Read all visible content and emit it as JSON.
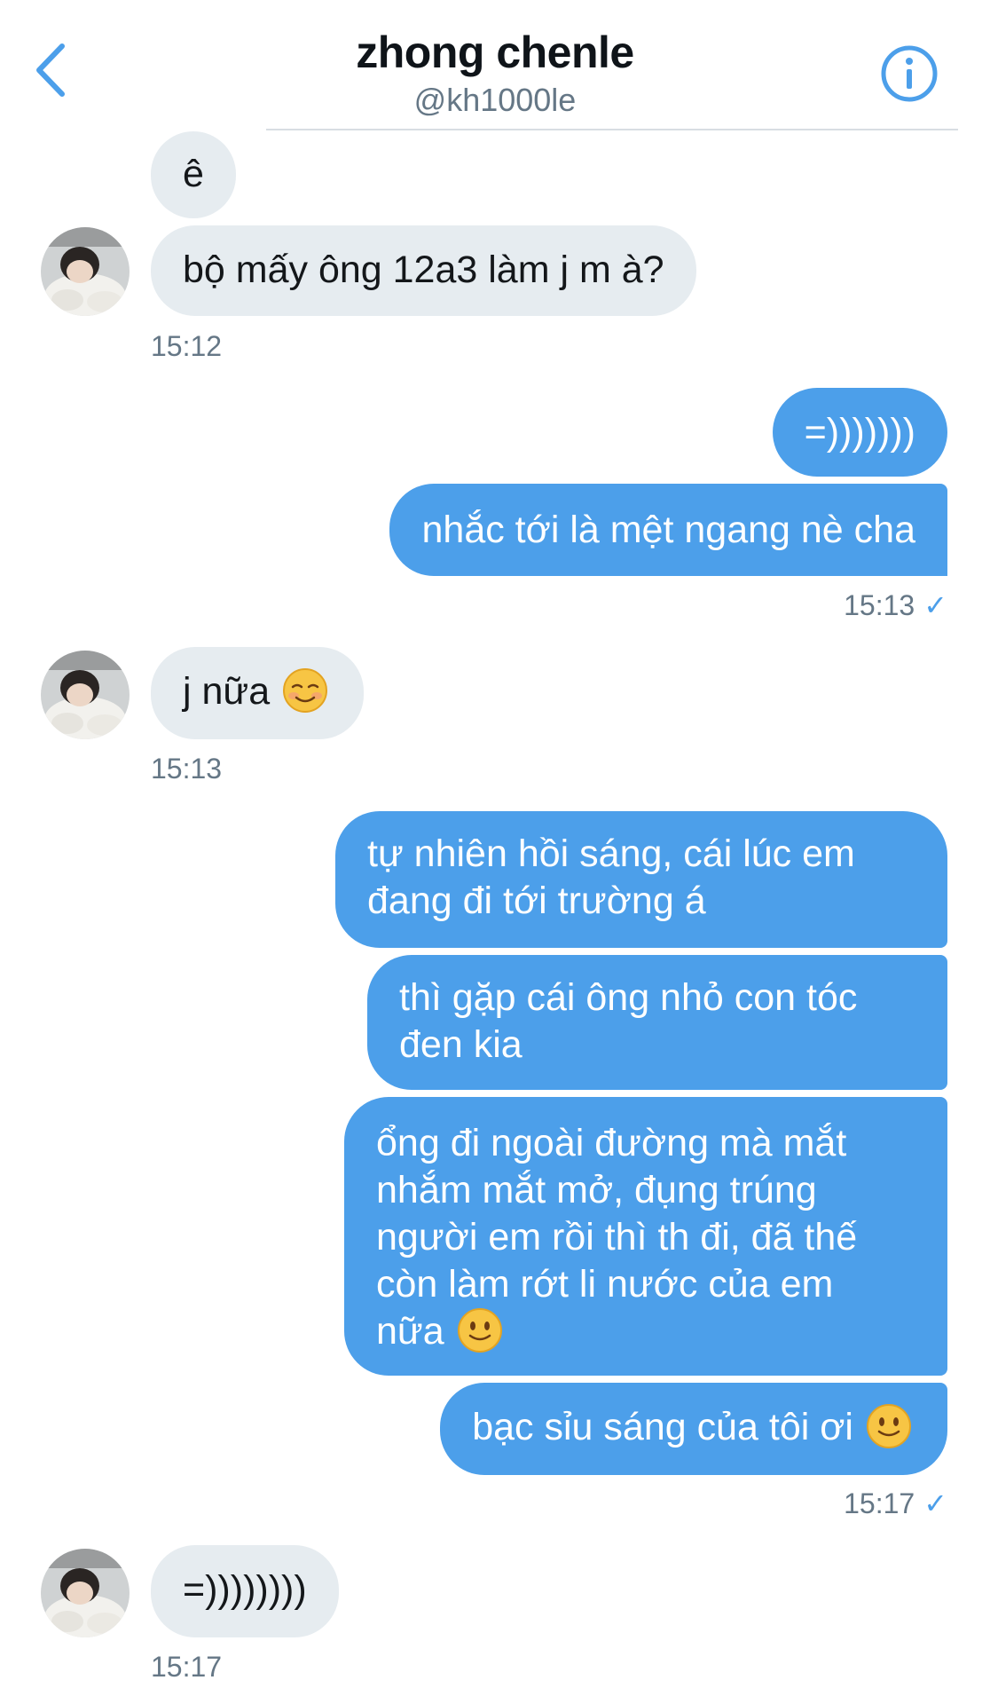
{
  "header": {
    "name": "zhong chenle",
    "handle": "@kh1000le",
    "back_icon": "chevron-left-icon",
    "info_icon": "info-icon"
  },
  "colors": {
    "accent": "#4c9fea",
    "incoming_bubble": "#e6ecf0",
    "outgoing_bubble": "#4c9fea",
    "timestamp": "#657786"
  },
  "messages": [
    {
      "from": "them",
      "text": "ê"
    },
    {
      "from": "them",
      "text": "bộ mấy ông 12a3 làm j m à?"
    },
    {
      "from": "meta",
      "time": "15:12"
    },
    {
      "from": "me",
      "text": "=)))))))"
    },
    {
      "from": "me",
      "text": "nhắc tới là mệt ngang nè cha"
    },
    {
      "from": "meta",
      "time": "15:13",
      "read_icon": "checkmark-icon"
    },
    {
      "from": "them",
      "text": "j nữa",
      "emoji": "smiling-face-icon"
    },
    {
      "from": "meta",
      "time": "15:13"
    },
    {
      "from": "me",
      "text": "tự nhiên hồi sáng, cái lúc em\nđang đi tới trường á"
    },
    {
      "from": "me",
      "text": "thì gặp cái ông nhỏ con tóc\nđen kia"
    },
    {
      "from": "me",
      "text": "ổng đi ngoài đường mà mắt\nnhắm mắt mở, đụng trúng\nngười em rồi thì th đi, đã thế\ncòn làm rớt li nước của em\nnữa",
      "emoji": "slightly-smiling-face-icon"
    },
    {
      "from": "me",
      "text": "bạc sỉu sáng của tôi ơi",
      "emoji": "slightly-smiling-face-icon"
    },
    {
      "from": "meta",
      "time": "15:17",
      "read_icon": "checkmark-icon"
    },
    {
      "from": "them",
      "text": "=))))))))"
    },
    {
      "from": "meta",
      "time": "15:17"
    }
  ]
}
